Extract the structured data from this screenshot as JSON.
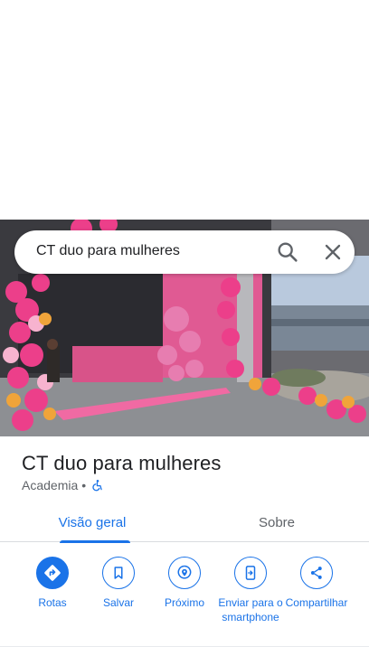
{
  "search": {
    "query": "CT duo para mulheres"
  },
  "place": {
    "name": "CT duo para mulheres",
    "category": "Academia",
    "separator": "•"
  },
  "tabs": [
    {
      "label": "Visão geral",
      "active": true
    },
    {
      "label": "Sobre",
      "active": false
    }
  ],
  "actions": [
    {
      "label": "Rotas",
      "icon": "directions-icon"
    },
    {
      "label": "Salvar",
      "icon": "bookmark-icon"
    },
    {
      "label": "Próximo",
      "icon": "nearby-icon"
    },
    {
      "label": "Enviar para o smartphone",
      "icon": "send-to-phone-icon"
    },
    {
      "label": "Compartilhar",
      "icon": "share-icon"
    }
  ],
  "colors": {
    "accent": "#1a73e8",
    "text_primary": "#202124",
    "text_secondary": "#5f6368"
  }
}
